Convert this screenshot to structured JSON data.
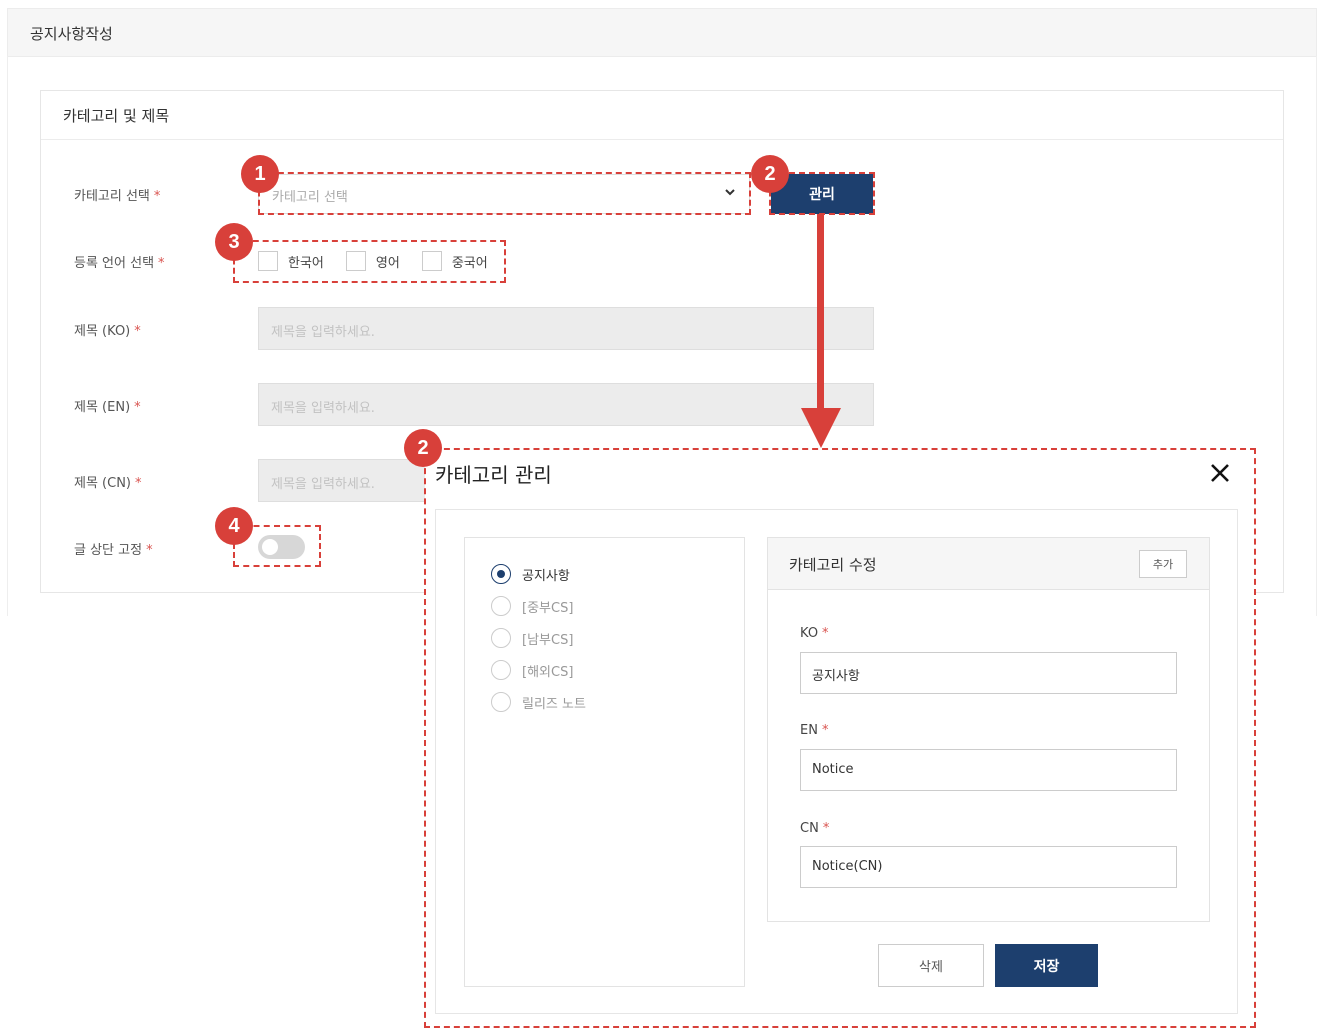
{
  "page": {
    "header_title": "공지사항작성"
  },
  "form_card": {
    "title": "카테고리 및 제목",
    "required_mark": "*",
    "category": {
      "label": "카테고리 선택",
      "placeholder": "카테고리 선택"
    },
    "manage_button": "관리",
    "language": {
      "label": "등록 언어 선택",
      "options": [
        "한국어",
        "영어",
        "중국어"
      ]
    },
    "title_ko": {
      "label": "제목 (KO)",
      "placeholder": "제목을 입력하세요."
    },
    "title_en": {
      "label": "제목 (EN)",
      "placeholder": "제목을 입력하세요."
    },
    "title_cn": {
      "label": "제목 (CN)",
      "placeholder": "제목을 입력하세요."
    },
    "pin_top": {
      "label": "글 상단 고정",
      "enabled": false
    }
  },
  "annotations": {
    "badges": [
      "1",
      "2",
      "3",
      "4",
      "2"
    ],
    "color": "#d8403a"
  },
  "modal": {
    "title": "카테고리 관리",
    "close_icon": "close-icon",
    "categories": [
      {
        "label": "공지사항",
        "selected": true
      },
      {
        "label": "[중부CS]",
        "selected": false
      },
      {
        "label": "[남부CS]",
        "selected": false
      },
      {
        "label": "[해외CS]",
        "selected": false
      },
      {
        "label": "릴리즈 노트",
        "selected": false
      }
    ],
    "edit_panel": {
      "title": "카테고리 수정",
      "add_button": "추가",
      "fields": [
        {
          "label": "KO",
          "value": "공지사항"
        },
        {
          "label": "EN",
          "value": "Notice"
        },
        {
          "label": "CN",
          "value": "Notice(CN)"
        }
      ]
    },
    "delete_button": "삭제",
    "save_button": "저장"
  },
  "colors": {
    "primary": "#1d3f6e",
    "annotation": "#d8403a",
    "required": "#d9534f"
  }
}
